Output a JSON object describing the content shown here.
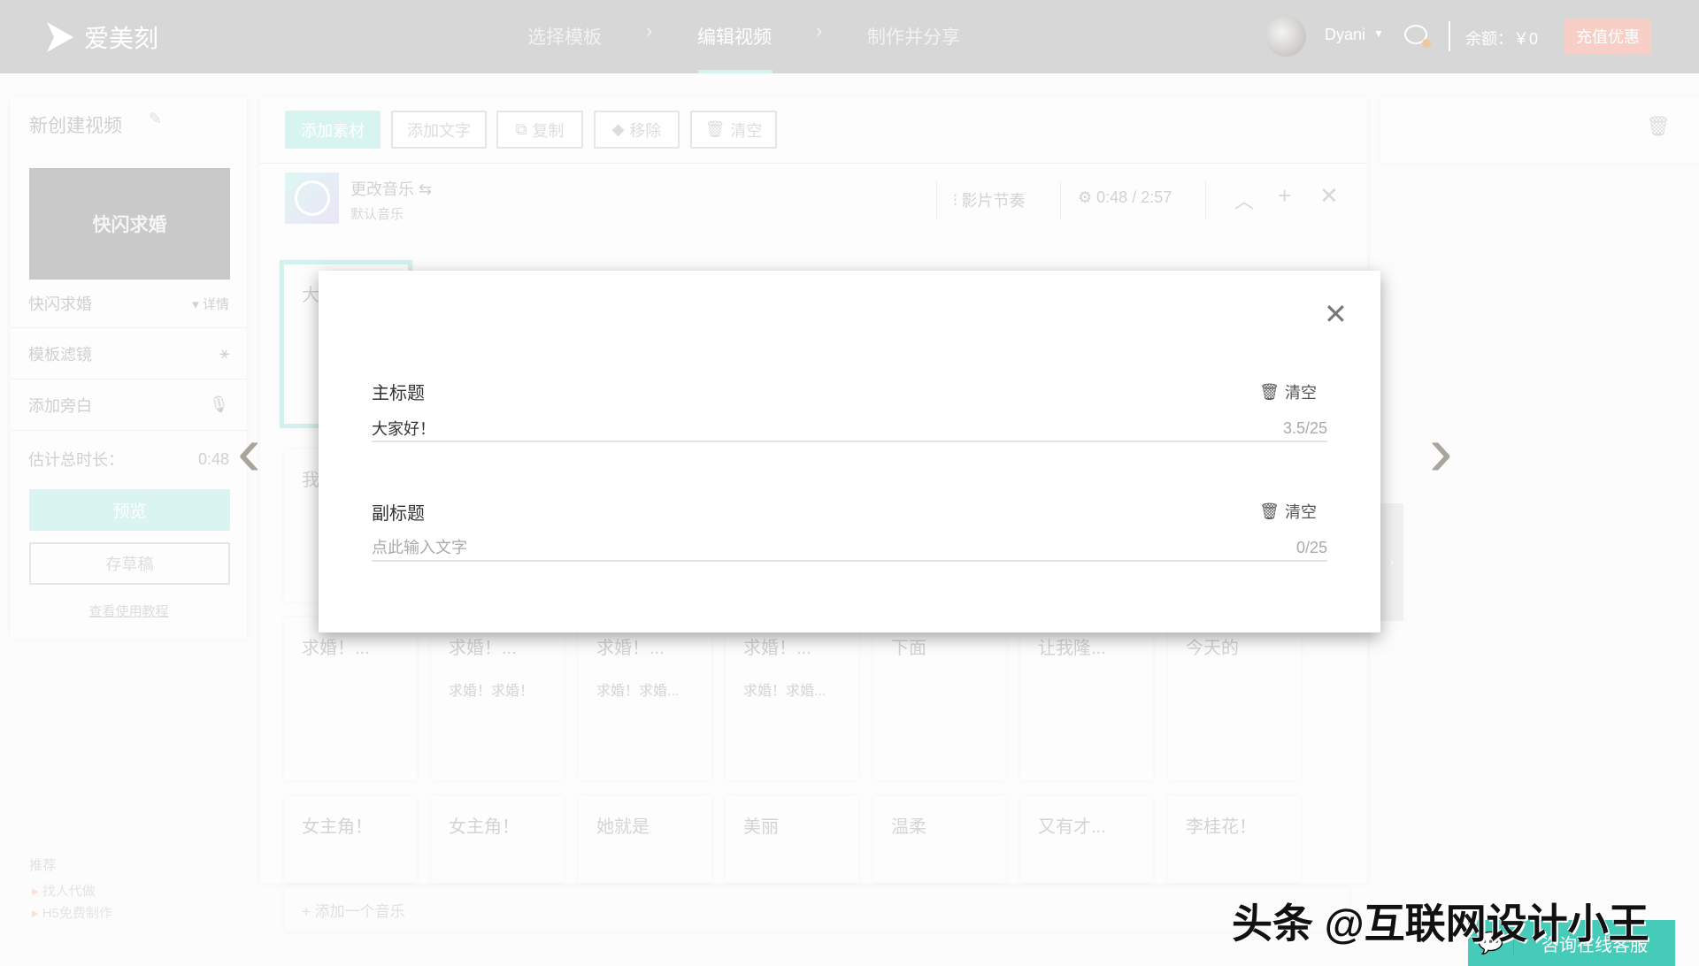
{
  "header": {
    "logo": "爱美刻",
    "steps": [
      "选择模板",
      "编辑视频",
      "制作并分享"
    ],
    "active_step": 1,
    "user": "Dyani",
    "balance": "余额：￥0",
    "recharge": "充值优惠"
  },
  "sidebar": {
    "title": "新创建视频",
    "thumb_title": "快闪求婚",
    "template_name": "快闪求婚",
    "details": "详情",
    "filter": "模板滤镜",
    "narration": "添加旁白",
    "duration_label": "估计总时长：",
    "duration": "0:48",
    "preview": "预览",
    "save_draft": "存草稿",
    "tutorial": "查看使用教程",
    "recommend": "推荐",
    "links": [
      "找人代做",
      "H5免费制作"
    ]
  },
  "toolbar": {
    "add_material": "添加素材",
    "add_text": "添加文字",
    "copy": "复制",
    "remove": "移除",
    "clear": "清空"
  },
  "music": {
    "change": "更改音乐",
    "default": "默认音乐",
    "rhythm": "影片节奏",
    "time": "0:48 / 2:57",
    "add_music": "+ 添加一个音乐"
  },
  "cards": {
    "row1": [
      "大"
    ],
    "row2": [
      "我"
    ],
    "row3": [
      {
        "t": "求婚！...",
        "s": ""
      },
      {
        "t": "求婚！...",
        "s": "求婚！求婚！"
      },
      {
        "t": "求婚！...",
        "s": "求婚！求婚..."
      },
      {
        "t": "求婚！...",
        "s": "求婚！求婚..."
      },
      {
        "t": "下面",
        "s": ""
      },
      {
        "t": "让我隆...",
        "s": ""
      },
      {
        "t": "今天的",
        "s": ""
      }
    ],
    "row4": [
      "女主角！",
      "女主角！",
      "她就是",
      "美丽",
      "温柔",
      "又有才...",
      "李桂花！"
    ]
  },
  "modal": {
    "main_title_label": "主标题",
    "clear": "清空",
    "main_title_value": "大家好！",
    "main_count": "3.5/25",
    "subtitle_label": "副标题",
    "subtitle_placeholder": "点此输入文字",
    "sub_count": "0/25"
  },
  "support": {
    "label": "咨询在线客服"
  },
  "watermark": "头条 @互联网设计小王",
  "colors": {
    "accent": "#45cbb8",
    "recharge": "#f8cfc6"
  }
}
